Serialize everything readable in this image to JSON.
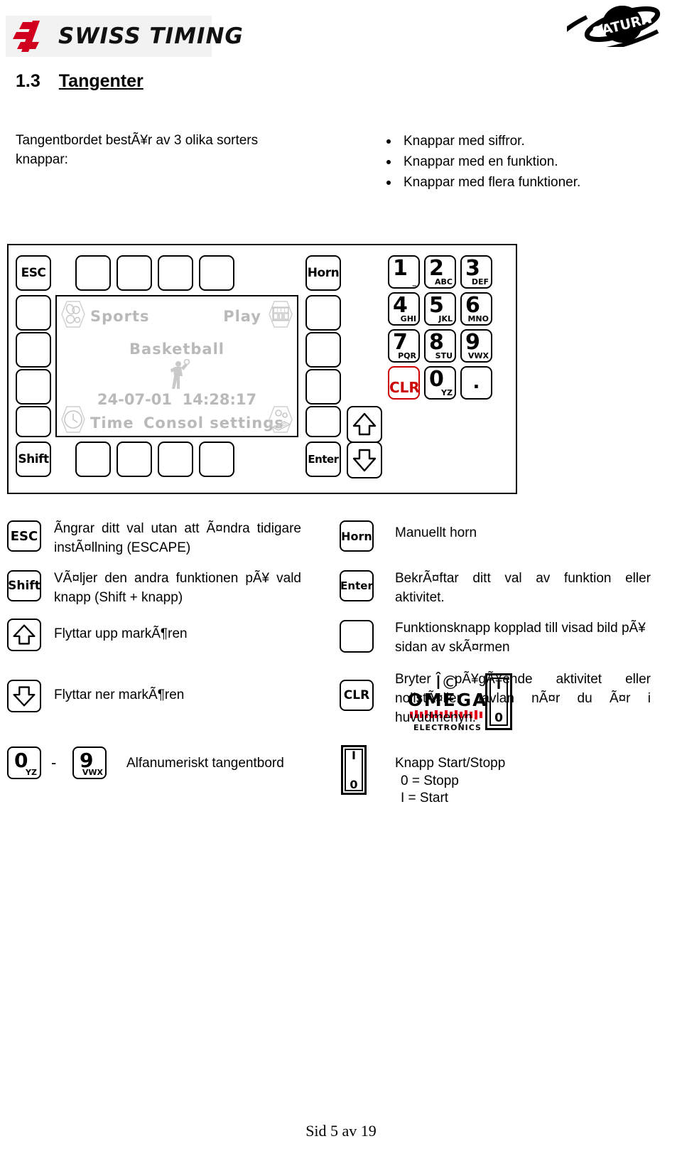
{
  "header": {
    "brand_text": "SWISS TIMING",
    "brand_mark": "swiss-timing-cross-icon",
    "brand_color": "#d1001f",
    "product_logo_text": "SATURN"
  },
  "section": {
    "number": "1.3",
    "title": "Tangenter"
  },
  "intro": {
    "lead": "Tangentbordet bestÃ¥r av 3 olika sorters knappar:",
    "bullets": [
      "Knappar med siffror.",
      "Knappar med en funktion.",
      "Knappar med flera funktioner."
    ]
  },
  "keyboard": {
    "left_column_keys": [
      "ESC",
      "",
      "",
      "",
      "",
      "Shift"
    ],
    "top_row_keys": [
      "",
      "",
      "",
      ""
    ],
    "bottom_row_keys": [
      "",
      "",
      "",
      ""
    ],
    "right_column_keys": [
      "Horn",
      "",
      "",
      "",
      "",
      "Enter"
    ],
    "lcd": {
      "sports_label": "Sports",
      "play_label": "Play",
      "sport_name": "Basketball",
      "date": "24-07-01",
      "time": "14:28:17",
      "time_label": "Time",
      "consol_label": "Consol settings",
      "icons": {
        "top_left": "sports-ball-icon",
        "top_right": "scoreboard-icon",
        "center": "basketball-player-icon",
        "bottom_left": "clock-icon",
        "bottom_right": "console-settings-icon"
      }
    },
    "numpad": [
      {
        "digit": "1",
        "sub": "_"
      },
      {
        "digit": "2",
        "sub": "ABC"
      },
      {
        "digit": "3",
        "sub": "DEF"
      },
      {
        "digit": "4",
        "sub": "GHI"
      },
      {
        "digit": "5",
        "sub": "JKL"
      },
      {
        "digit": "6",
        "sub": "MNO"
      },
      {
        "digit": "7",
        "sub": "PQR"
      },
      {
        "digit": "8",
        "sub": "STU"
      },
      {
        "digit": "9",
        "sub": "VWX"
      },
      {
        "digit": "CLR",
        "sub": ""
      },
      {
        "digit": "0",
        "sub": "YZ"
      },
      {
        "digit": ".",
        "sub": ""
      }
    ],
    "clr_color": "#cc0000",
    "arrows": {
      "up": "arrow-up-icon",
      "down": "arrow-down-icon"
    },
    "omega": {
      "symbol": "Î©",
      "word": "OMEGA",
      "subtitle": "ELECTRONICS",
      "bar_color": "#e2001a"
    },
    "power_switch": {
      "on": "I",
      "off": "0"
    }
  },
  "legend": {
    "left": [
      {
        "key_label": "ESC",
        "key_type": "text",
        "desc": "Ãngrar ditt val utan att Ã¤ndra tidigare instÃ¤llning (ESCAPE)"
      },
      {
        "key_label": "Shift",
        "key_type": "text",
        "desc": "VÃ¤ljer den andra funktionen pÃ¥ vald knapp (Shift + knapp)"
      },
      {
        "key_label": "arrow-up-icon",
        "key_type": "arrow-up",
        "desc": "Flyttar upp markÃ¶ren"
      },
      {
        "key_label": "arrow-down-icon",
        "key_type": "arrow-down",
        "desc": "Flyttar ner markÃ¶ren"
      }
    ],
    "right": [
      {
        "key_label": "Horn",
        "key_type": "text",
        "desc": "Manuellt horn"
      },
      {
        "key_label": "Enter",
        "key_type": "text",
        "desc": "BekrÃ¤ftar ditt val av funktion eller aktivitet."
      },
      {
        "key_label": "",
        "key_type": "blank",
        "desc": "Funktionsknapp kopplad till visad bild pÃ¥ sidan av skÃ¤rmen"
      },
      {
        "key_label": "CLR",
        "key_type": "text",
        "desc": "Bryter pÃ¥gÃ¥ende aktivitet eller nollstÃ¤ller tavlan nÃ¤r du Ã¤r i huvudmenyn."
      },
      {
        "key_label": "power-switch-icon",
        "key_type": "switch",
        "desc": "Knapp Start/Stopp",
        "desc_line2": "0 = Stopp",
        "desc_line3": "I =  Start"
      }
    ],
    "alnum_row": {
      "from_digit": "0",
      "from_sub": "YZ",
      "separator": "-",
      "to_digit": "9",
      "to_sub": "VWX",
      "desc": "Alfanumeriskt tangentbord"
    }
  },
  "footer": {
    "page_text": "Sid 5 av 19"
  }
}
